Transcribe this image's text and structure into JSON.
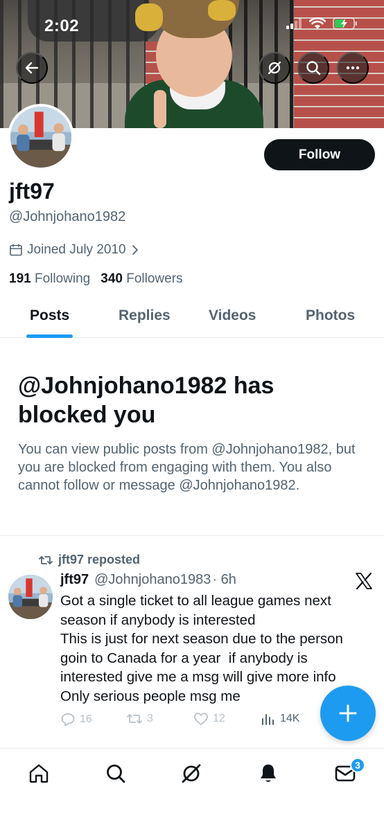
{
  "status_bar": {
    "time": "2:02"
  },
  "profile": {
    "display_name": "jft97",
    "handle": "@Johnjohano1982",
    "joined": "Joined July 2010",
    "following_count": "191",
    "following_label": "Following",
    "followers_count": "340",
    "followers_label": "Followers",
    "follow_label": "Follow"
  },
  "tabs": [
    {
      "label": "Posts",
      "active": true
    },
    {
      "label": "Replies",
      "active": false
    },
    {
      "label": "Videos",
      "active": false
    },
    {
      "label": "Photos",
      "active": false
    }
  ],
  "blocked": {
    "title": "@Johnjohano1982 has blocked you",
    "text": "You can view public posts from @Johnjohano1982, but you are blocked from engaging with them. You also cannot follow or message @Johnjohano1982."
  },
  "post": {
    "repost_label": "jft97 reposted",
    "author_name": "jft97",
    "author_handle": "@Johnjohano1983",
    "time": "· 6h",
    "lines": [
      "Got a single ticket to all league games next",
      "season if anybody is interested",
      "This is just for next season due to the person",
      "goin to Canada for a year  if anybody is",
      "interested give me a msg will give more info",
      "Only serious people msg me"
    ],
    "replies": "16",
    "reposts": "3",
    "likes": "12",
    "views": "14K"
  },
  "nav": {
    "messages_badge": "3"
  },
  "colors": {
    "accent": "#1d9bf0",
    "text": "#0f1419",
    "muted": "#536471"
  }
}
